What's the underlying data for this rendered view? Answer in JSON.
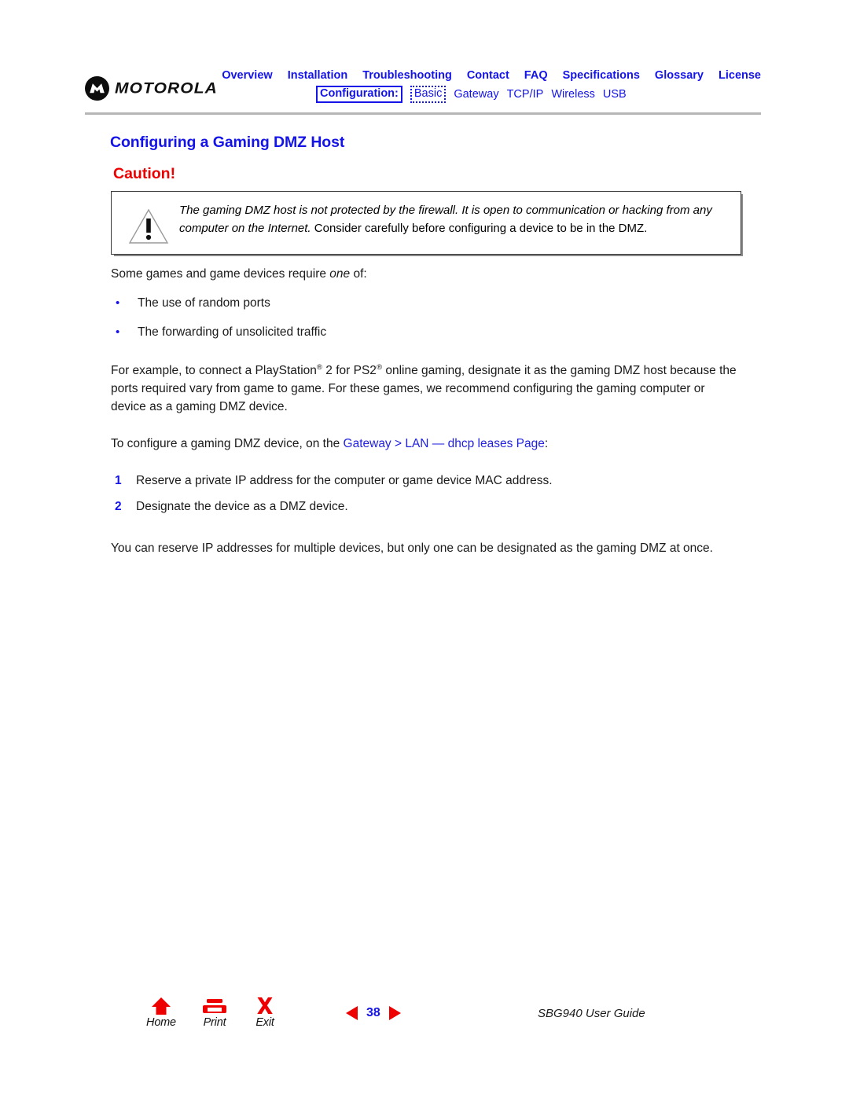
{
  "header": {
    "brand": "MOTOROLA",
    "logo_icon": "motorola-batwing-logo",
    "nav_primary": [
      {
        "label": "Overview"
      },
      {
        "label": "Installation"
      },
      {
        "label": "Troubleshooting"
      },
      {
        "label": "Contact"
      },
      {
        "label": "FAQ"
      },
      {
        "label": "Specifications"
      },
      {
        "label": "Glossary"
      },
      {
        "label": "License"
      }
    ],
    "nav_secondary": {
      "group_label": "Configuration:",
      "current": "Basic",
      "items": [
        {
          "label": "Gateway"
        },
        {
          "label": "TCP/IP"
        },
        {
          "label": "Wireless"
        },
        {
          "label": "USB"
        }
      ]
    }
  },
  "titles": {
    "page_title": "Configuring a Gaming DMZ Host",
    "caution_heading": "Caution!"
  },
  "caution": {
    "icon": "warning-triangle-icon",
    "text_italic": "The gaming DMZ host is not protected by the firewall. It is open to communication or hacking from any computer on the Internet.",
    "text_regular": "Consider carefully before configuring a device to be in the DMZ."
  },
  "body": {
    "intro_before_italic": "Some games and game devices require ",
    "intro_italic": "one",
    "intro_after_italic": " of:",
    "bullets": [
      {
        "text": "The use of random ports"
      },
      {
        "text": "The forwarding of unsolicited traffic"
      }
    ],
    "example_part1": "For example, to connect a PlayStation",
    "example_sup1": "®",
    "example_part2": " 2 for PS2",
    "example_sup2": "®",
    "example_part3": " online gaming, designate it as the gaming DMZ host because the ports required vary from game to game. For these games, we recommend configuring the gaming computer or device as a gaming DMZ device.",
    "configure_lead": "To configure a gaming DMZ device, on the ",
    "configure_link": "Gateway > LAN — dhcp leases Page",
    "configure_tail": ":",
    "steps": [
      {
        "num": "1",
        "text": "Reserve a private IP address for the computer or game device MAC address."
      },
      {
        "num": "2",
        "text": "Designate the device as a DMZ device."
      }
    ],
    "closing": "You can reserve IP addresses for multiple devices, but only one can be designated as the gaming DMZ at once."
  },
  "footer": {
    "buttons": [
      {
        "id": "home",
        "label": "Home",
        "icon": "home-icon"
      },
      {
        "id": "print",
        "label": "Print",
        "icon": "printer-icon"
      },
      {
        "id": "exit",
        "label": "Exit",
        "icon": "close-x-icon"
      }
    ],
    "prev_icon": "triangle-left-icon",
    "next_icon": "triangle-right-icon",
    "page_number": "38",
    "guide_label": "SBG940 User Guide"
  },
  "colors": {
    "link_blue": "#1414e8",
    "caution_red": "#ee0000",
    "rule_gray": "#b6b6b6"
  }
}
